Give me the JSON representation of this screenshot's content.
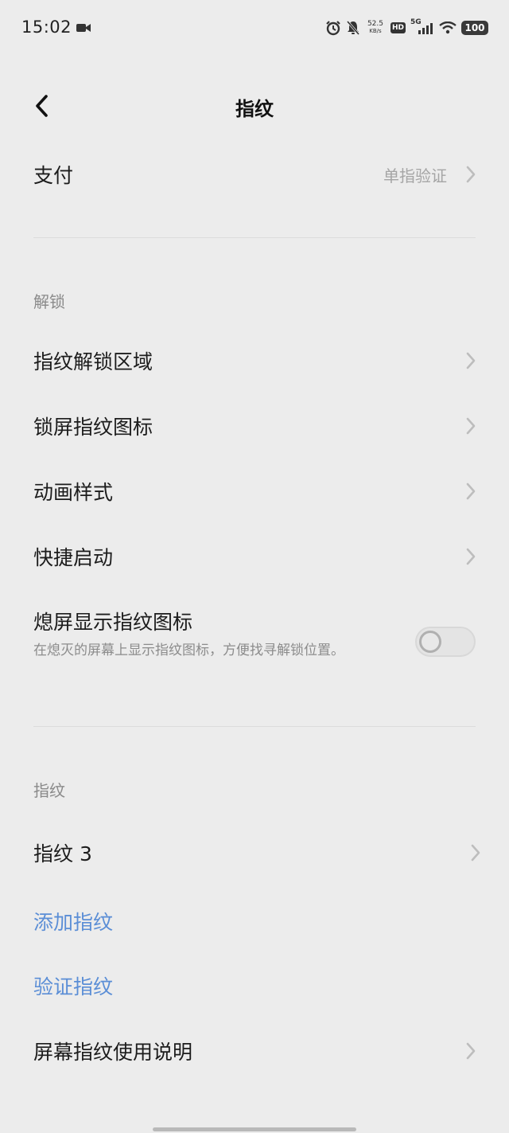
{
  "status_bar": {
    "time": "15:02",
    "net_speed_value": "52.5",
    "net_speed_unit": "KB/s",
    "hd": "HD",
    "signal": "5G",
    "battery": "100"
  },
  "header": {
    "title": "指纹"
  },
  "payment": {
    "label": "支付",
    "value": "单指验证"
  },
  "unlock_section": {
    "header": "解锁",
    "items": [
      {
        "label": "指纹解锁区域"
      },
      {
        "label": "锁屏指纹图标"
      },
      {
        "label": "动画样式"
      },
      {
        "label": "快捷启动"
      }
    ],
    "aod": {
      "label": "熄屏显示指纹图标",
      "description": "在熄灭的屏幕上显示指纹图标，方便找寻解锁位置。",
      "enabled": false
    }
  },
  "fingerprint_section": {
    "header": "指纹",
    "fingerprint_item": "指纹 3",
    "add_fingerprint": "添加指纹",
    "verify_fingerprint": "验证指纹",
    "usage_guide": "屏幕指纹使用说明"
  },
  "colors": {
    "background": "#ececec",
    "link_blue": "#5b8ed6",
    "secondary_text": "#8a8a8a"
  }
}
